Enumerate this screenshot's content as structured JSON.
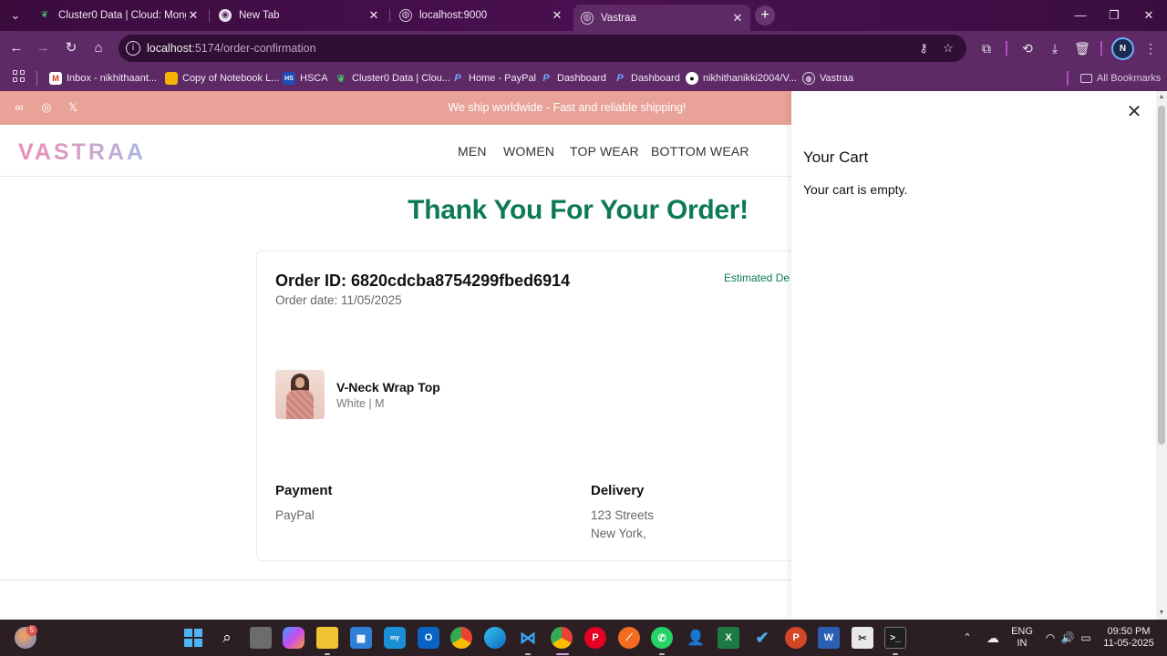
{
  "browser": {
    "tabs": [
      {
        "label": "Cluster0 Data | Cloud: MongoDB",
        "active": false
      },
      {
        "label": "New Tab",
        "active": false
      },
      {
        "label": "localhost:9000",
        "active": false
      },
      {
        "label": "Vastraa",
        "active": true
      }
    ],
    "url_host": "localhost",
    "url_path": ":5174/order-confirmation",
    "profile_initial": "N",
    "bookmarks": [
      "Inbox - nikhithaant...",
      "Copy of Notebook L...",
      "HSCA",
      "Cluster0 Data | Clou...",
      "Home - PayPal",
      "Dashboard",
      "Dashboard",
      "nikhithanikki2004/V...",
      "Vastraa"
    ],
    "all_bookmarks": "All Bookmarks"
  },
  "site": {
    "promo_text": "We ship worldwide - Fast and reliable shipping!",
    "logo": "VASTRAA",
    "nav": [
      "MEN",
      "WOMEN",
      "TOP WEAR",
      "BOTTOM WEAR"
    ]
  },
  "confirmation": {
    "heading": "Thank You For Your Order!",
    "order_id": "Order ID: 6820cdcba8754299fbed6914",
    "order_date": "Order date: 11/05/2025",
    "estimated": "Estimated De",
    "item": {
      "name": "V-Neck Wrap Top",
      "variant": "White | M"
    },
    "payment": {
      "title": "Payment",
      "method": "PayPal"
    },
    "delivery": {
      "title": "Delivery",
      "line1": "123 Streets",
      "line2": "New York,"
    }
  },
  "cart": {
    "title": "Your Cart",
    "empty_text": "Your cart is empty."
  },
  "taskbar": {
    "notification_count": "5",
    "lang_top": "ENG",
    "lang_bottom": "IN",
    "time": "09:50 PM",
    "date": "11-05-2025"
  },
  "colors": {
    "accent_green": "#0d7a55",
    "promo_bg": "#e8a298",
    "chrome_bg": "#5e2a66"
  }
}
